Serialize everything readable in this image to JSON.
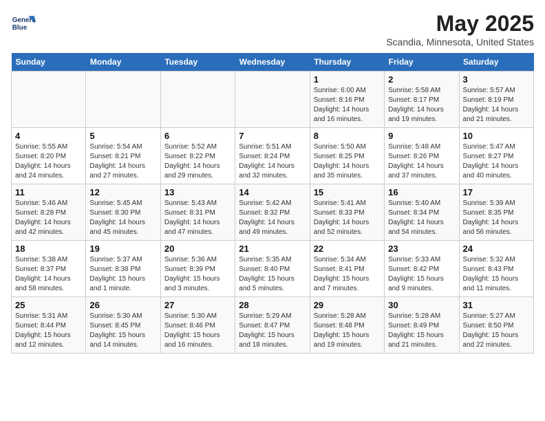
{
  "header": {
    "logo_line1": "General",
    "logo_line2": "Blue",
    "month": "May 2025",
    "location": "Scandia, Minnesota, United States"
  },
  "days_of_week": [
    "Sunday",
    "Monday",
    "Tuesday",
    "Wednesday",
    "Thursday",
    "Friday",
    "Saturday"
  ],
  "weeks": [
    [
      {
        "day": "",
        "detail": ""
      },
      {
        "day": "",
        "detail": ""
      },
      {
        "day": "",
        "detail": ""
      },
      {
        "day": "",
        "detail": ""
      },
      {
        "day": "1",
        "detail": "Sunrise: 6:00 AM\nSunset: 8:16 PM\nDaylight: 14 hours\nand 16 minutes."
      },
      {
        "day": "2",
        "detail": "Sunrise: 5:58 AM\nSunset: 8:17 PM\nDaylight: 14 hours\nand 19 minutes."
      },
      {
        "day": "3",
        "detail": "Sunrise: 5:57 AM\nSunset: 8:19 PM\nDaylight: 14 hours\nand 21 minutes."
      }
    ],
    [
      {
        "day": "4",
        "detail": "Sunrise: 5:55 AM\nSunset: 8:20 PM\nDaylight: 14 hours\nand 24 minutes."
      },
      {
        "day": "5",
        "detail": "Sunrise: 5:54 AM\nSunset: 8:21 PM\nDaylight: 14 hours\nand 27 minutes."
      },
      {
        "day": "6",
        "detail": "Sunrise: 5:52 AM\nSunset: 8:22 PM\nDaylight: 14 hours\nand 29 minutes."
      },
      {
        "day": "7",
        "detail": "Sunrise: 5:51 AM\nSunset: 8:24 PM\nDaylight: 14 hours\nand 32 minutes."
      },
      {
        "day": "8",
        "detail": "Sunrise: 5:50 AM\nSunset: 8:25 PM\nDaylight: 14 hours\nand 35 minutes."
      },
      {
        "day": "9",
        "detail": "Sunrise: 5:48 AM\nSunset: 8:26 PM\nDaylight: 14 hours\nand 37 minutes."
      },
      {
        "day": "10",
        "detail": "Sunrise: 5:47 AM\nSunset: 8:27 PM\nDaylight: 14 hours\nand 40 minutes."
      }
    ],
    [
      {
        "day": "11",
        "detail": "Sunrise: 5:46 AM\nSunset: 8:28 PM\nDaylight: 14 hours\nand 42 minutes."
      },
      {
        "day": "12",
        "detail": "Sunrise: 5:45 AM\nSunset: 8:30 PM\nDaylight: 14 hours\nand 45 minutes."
      },
      {
        "day": "13",
        "detail": "Sunrise: 5:43 AM\nSunset: 8:31 PM\nDaylight: 14 hours\nand 47 minutes."
      },
      {
        "day": "14",
        "detail": "Sunrise: 5:42 AM\nSunset: 8:32 PM\nDaylight: 14 hours\nand 49 minutes."
      },
      {
        "day": "15",
        "detail": "Sunrise: 5:41 AM\nSunset: 8:33 PM\nDaylight: 14 hours\nand 52 minutes."
      },
      {
        "day": "16",
        "detail": "Sunrise: 5:40 AM\nSunset: 8:34 PM\nDaylight: 14 hours\nand 54 minutes."
      },
      {
        "day": "17",
        "detail": "Sunrise: 5:39 AM\nSunset: 8:35 PM\nDaylight: 14 hours\nand 56 minutes."
      }
    ],
    [
      {
        "day": "18",
        "detail": "Sunrise: 5:38 AM\nSunset: 8:37 PM\nDaylight: 14 hours\nand 58 minutes."
      },
      {
        "day": "19",
        "detail": "Sunrise: 5:37 AM\nSunset: 8:38 PM\nDaylight: 15 hours\nand 1 minute."
      },
      {
        "day": "20",
        "detail": "Sunrise: 5:36 AM\nSunset: 8:39 PM\nDaylight: 15 hours\nand 3 minutes."
      },
      {
        "day": "21",
        "detail": "Sunrise: 5:35 AM\nSunset: 8:40 PM\nDaylight: 15 hours\nand 5 minutes."
      },
      {
        "day": "22",
        "detail": "Sunrise: 5:34 AM\nSunset: 8:41 PM\nDaylight: 15 hours\nand 7 minutes."
      },
      {
        "day": "23",
        "detail": "Sunrise: 5:33 AM\nSunset: 8:42 PM\nDaylight: 15 hours\nand 9 minutes."
      },
      {
        "day": "24",
        "detail": "Sunrise: 5:32 AM\nSunset: 8:43 PM\nDaylight: 15 hours\nand 11 minutes."
      }
    ],
    [
      {
        "day": "25",
        "detail": "Sunrise: 5:31 AM\nSunset: 8:44 PM\nDaylight: 15 hours\nand 12 minutes."
      },
      {
        "day": "26",
        "detail": "Sunrise: 5:30 AM\nSunset: 8:45 PM\nDaylight: 15 hours\nand 14 minutes."
      },
      {
        "day": "27",
        "detail": "Sunrise: 5:30 AM\nSunset: 8:46 PM\nDaylight: 15 hours\nand 16 minutes."
      },
      {
        "day": "28",
        "detail": "Sunrise: 5:29 AM\nSunset: 8:47 PM\nDaylight: 15 hours\nand 18 minutes."
      },
      {
        "day": "29",
        "detail": "Sunrise: 5:28 AM\nSunset: 8:48 PM\nDaylight: 15 hours\nand 19 minutes."
      },
      {
        "day": "30",
        "detail": "Sunrise: 5:28 AM\nSunset: 8:49 PM\nDaylight: 15 hours\nand 21 minutes."
      },
      {
        "day": "31",
        "detail": "Sunrise: 5:27 AM\nSunset: 8:50 PM\nDaylight: 15 hours\nand 22 minutes."
      }
    ]
  ]
}
